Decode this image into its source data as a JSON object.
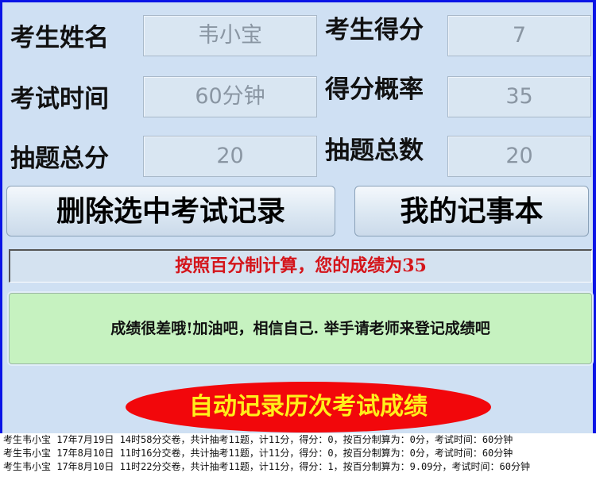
{
  "form": {
    "name_label": "考生姓名",
    "name_value": "韦小宝",
    "score_label": "考生得分",
    "score_value": "7",
    "time_label": "考试时间",
    "time_value": "60分钟",
    "rate_label": "得分概率",
    "rate_value": "35",
    "total_label": "抽题总分",
    "total_value": "20",
    "count_label": "抽题总数",
    "count_value": "20"
  },
  "buttons": {
    "delete_label": "删除选中考试记录",
    "notebook_label": "我的记事本"
  },
  "result_text": "按照百分制计算，您的成绩为35",
  "comment_text": "成绩很差哦!加油吧，相信自己. 举手请老师来登记成绩吧",
  "auto_record_label": "自动记录历次考试成绩",
  "records": [
    "考生韦小宝 17年7月19日 14时58分交卷，共计抽考11题，计11分，得分：0，按百分制算为：0分，考试时间：60分钟",
    "考生韦小宝 17年8月10日 11时16分交卷，共计抽考11题，计11分，得分：0，按百分制算为：0分，考试时间：60分钟",
    "考生韦小宝 17年8月10日 11时22分交卷，共计抽考11题，计11分，得分：1，按百分制算为：9.09分，考试时间：60分钟"
  ],
  "colors": {
    "frame": "#0a14e6",
    "panel": "#cfe0f3",
    "result_text": "#d4151b",
    "comment_bg": "#c6f2c0",
    "oval_bg": "#f2070b",
    "oval_text": "#ffef1a"
  }
}
